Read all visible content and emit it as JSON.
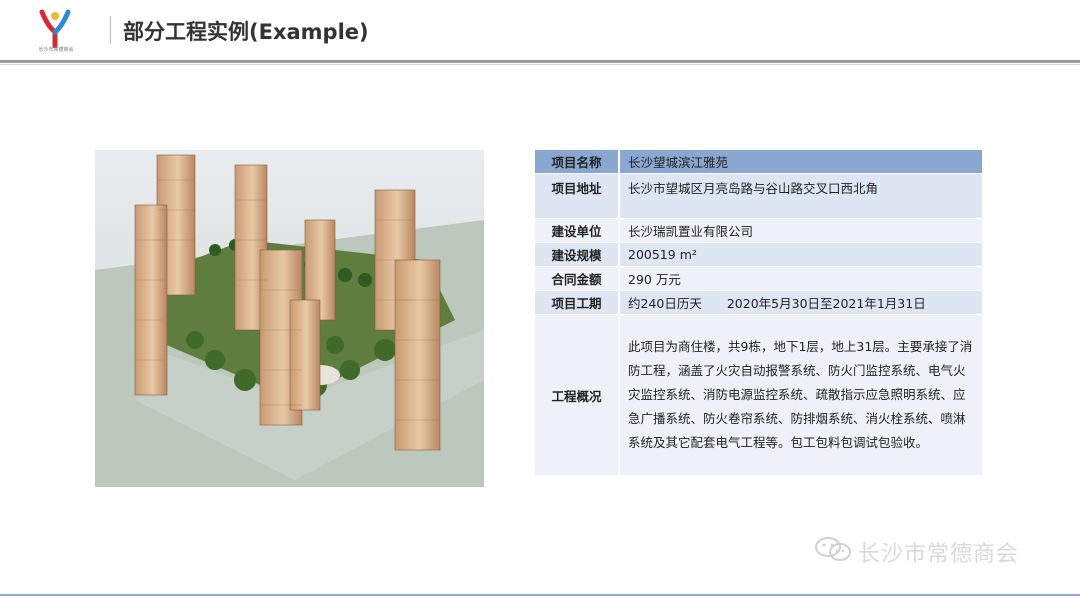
{
  "header": {
    "title": "部分工程实例(Example)",
    "logo_caption": "长沙市常德商会"
  },
  "project": {
    "rows": [
      {
        "label": "项目名称",
        "value": "长沙望城滨江雅苑"
      },
      {
        "label": "项目地址",
        "value": "长沙市望城区月亮岛路与谷山路交叉口西北角"
      },
      {
        "label": "建设单位",
        "value": "长沙瑞凯置业有限公司"
      },
      {
        "label": "建设规模",
        "value": "200519 m²"
      },
      {
        "label": "合同金额",
        "value": "290 万元"
      },
      {
        "label": "项目工期",
        "value": "约240日历天　　2020年5月30日至2021年1月31日"
      }
    ],
    "overview_label": "工程概况",
    "overview_text": "此项目为商住楼，共9栋，地下1层，地上31层。主要承接了消防工程，涵盖了火灾自动报警系统、防火门监控系统、电气火灾监控系统、消防电源监控系统、疏散指示应急照明系统、应急广播系统、防火卷帘系统、防排烟系统、消火栓系统、喷淋系统及其它配套电气工程等。包工包料包调试包验收。"
  },
  "watermark": {
    "text": "长沙市常德商会",
    "icon": "wechat-icon"
  },
  "colors": {
    "header_row": "#8aa7d1",
    "row_even": "#dde6f2",
    "row_odd": "#eef2f8",
    "bottom_rule": "#8faad6"
  }
}
